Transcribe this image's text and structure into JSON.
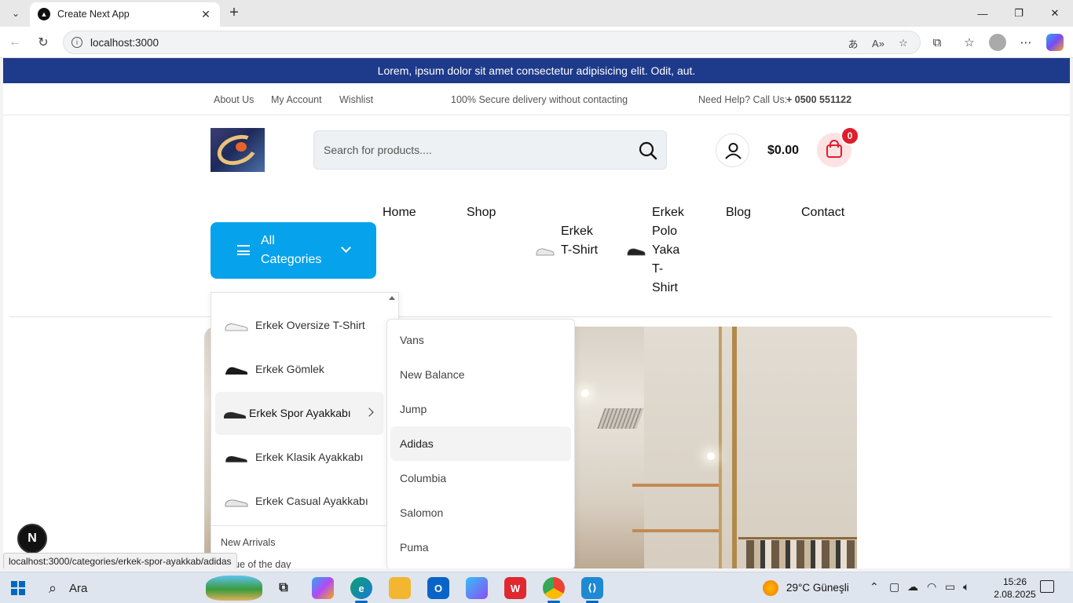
{
  "browser": {
    "tab_title": "Create Next App",
    "url": "localhost:3000",
    "status_url": "localhost:3000/categories/erkek-spor-ayakkab/adidas"
  },
  "site": {
    "announcement": "Lorem, ipsum dolor sit amet consectetur adipisicing elit. Odit, aut.",
    "topbar": {
      "about": "About Us",
      "account": "My Account",
      "wishlist": "Wishlist",
      "delivery": "100% Secure delivery without contacting",
      "help": "Need Help? Call Us:",
      "phone": "+ 0500 551122"
    },
    "search_placeholder": "Search for products....",
    "cart_total": "$0.00",
    "cart_count": "0",
    "nav": {
      "home": "Home",
      "shop": "Shop",
      "erkek_tshirt": "Erkek T-Shirt",
      "erkek_polo": "Erkek Polo Yaka T-Shirt",
      "blog": "Blog",
      "contact": "Contact"
    },
    "all_categories": "All Categories",
    "categories": [
      {
        "label": "Erkek Oversize T-Shirt"
      },
      {
        "label": "Erkek Gömlek"
      },
      {
        "label": "Erkek Spor Ayakkabı"
      },
      {
        "label": "Erkek Klasik Ayakkabı"
      },
      {
        "label": "Erkek Casual Ayakkabı"
      }
    ],
    "extra_links": {
      "new_arrivals": "New Arrivals",
      "value_of_day": "Value of the day"
    },
    "subcategories": [
      "Vans",
      "New Balance",
      "Jump",
      "Adidas",
      "Columbia",
      "Salomon",
      "Puma"
    ],
    "next_badge": "N"
  },
  "taskbar": {
    "search_label": "Ara",
    "weather": "29°C  Güneşli",
    "time": "15:26",
    "date": "2.08.2025"
  },
  "colors": {
    "announcement_bg": "#1e3a8a",
    "all_categories_bg": "#06a2ec",
    "cart_badge": "#e11d2b"
  }
}
